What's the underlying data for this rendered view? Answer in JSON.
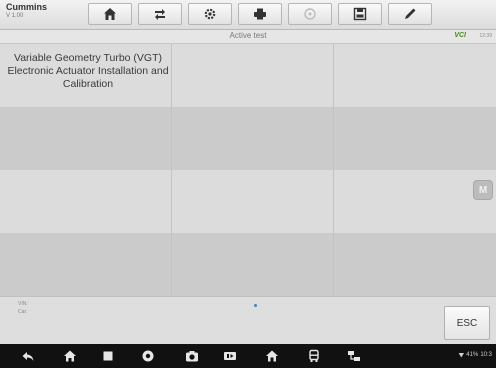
{
  "toolbar": {
    "brand_name": "Cummins",
    "brand_version": "V 1.00",
    "buttons": [
      {
        "icon": "home-icon"
      },
      {
        "icon": "vehicle-swap-icon"
      },
      {
        "icon": "settings-gear-icon"
      },
      {
        "icon": "print-icon"
      },
      {
        "icon": "help-icon"
      },
      {
        "icon": "save-icon"
      },
      {
        "icon": "pen-icon"
      }
    ]
  },
  "subheader": {
    "title": "Active test",
    "vci_label": "VCI",
    "clock": "12:39"
  },
  "grid": {
    "rows": [
      [
        "Variable Geometry Turbo (VGT) Electronic Actuator Installation and Calibration",
        "",
        ""
      ],
      [
        "",
        "",
        ""
      ],
      [
        "",
        "",
        ""
      ],
      [
        "",
        "",
        ""
      ]
    ]
  },
  "side_button": "M",
  "info": {
    "vin_label": "VIN:",
    "car_label": "Car:"
  },
  "esc_label": "ESC",
  "statusbar": {
    "battery": "41%",
    "time": "10:3"
  },
  "colors": {
    "vci_green": "#4a8a1c",
    "background_gray": "#d4d4d4",
    "navbar_black": "#111111"
  }
}
